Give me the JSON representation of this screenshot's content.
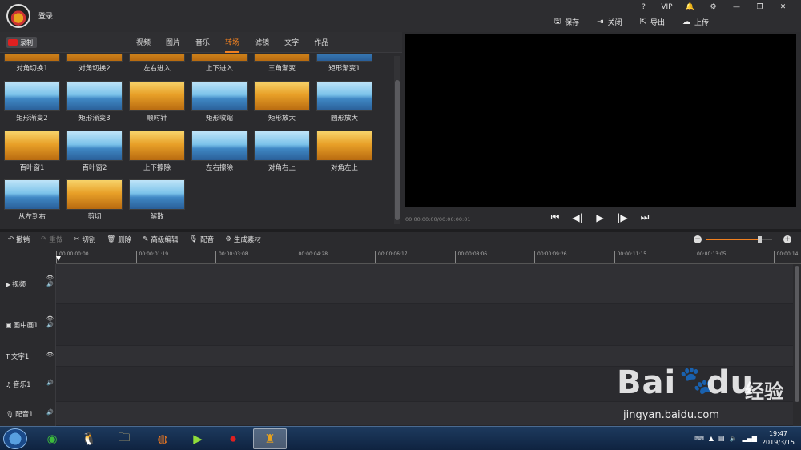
{
  "app": {
    "login_label": "登录",
    "system_icons": [
      "?",
      "VIP",
      "🔔",
      "⚙",
      "—",
      "❐",
      "✕"
    ],
    "actions": [
      {
        "icon": "save-icon",
        "glyph": "🖫",
        "label": "保存"
      },
      {
        "icon": "close-doc-icon",
        "glyph": "⇥",
        "label": "关闭"
      },
      {
        "icon": "export-icon",
        "glyph": "⇱",
        "label": "导出"
      },
      {
        "icon": "upload-icon",
        "glyph": "☁",
        "label": "上传"
      }
    ]
  },
  "library": {
    "record_label": "录制",
    "tabs": [
      "视频",
      "图片",
      "音乐",
      "转场",
      "滤镜",
      "文字",
      "作品"
    ],
    "active_tab": "转场",
    "transitions": [
      {
        "label": "对角切换1",
        "style": "wheat"
      },
      {
        "label": "对角切换2",
        "style": "wheat"
      },
      {
        "label": "左右进入",
        "style": "wheat"
      },
      {
        "label": "上下进入",
        "style": "wheat"
      },
      {
        "label": "三角渐变",
        "style": "wheat"
      },
      {
        "label": "矩形渐变1",
        "style": "lake"
      },
      {
        "label": "矩形渐变2",
        "style": "lake"
      },
      {
        "label": "矩形渐变3",
        "style": "lake"
      },
      {
        "label": "顺时针",
        "style": "wheat"
      },
      {
        "label": "矩形收缩",
        "style": "lake"
      },
      {
        "label": "矩形放大",
        "style": "wheat"
      },
      {
        "label": "圆形放大",
        "style": "lake"
      },
      {
        "label": "百叶窗1",
        "style": "wheat"
      },
      {
        "label": "百叶窗2",
        "style": "lake"
      },
      {
        "label": "上下擦除",
        "style": "wheat"
      },
      {
        "label": "左右擦除",
        "style": "lake"
      },
      {
        "label": "对角右上",
        "style": "lake"
      },
      {
        "label": "对角左上",
        "style": "wheat"
      },
      {
        "label": "从左到右",
        "style": "lake"
      },
      {
        "label": "剪切",
        "style": "wheat"
      },
      {
        "label": "解散",
        "style": "lake"
      }
    ]
  },
  "preview": {
    "timecode": "00:00:00:00/00:00:00:01",
    "controls": [
      "⏮",
      "◀|",
      "▶",
      "|▶",
      "⏭"
    ]
  },
  "toolbar": {
    "tools": [
      {
        "icon": "undo-icon",
        "glyph": "↶",
        "label": "撤销",
        "enabled": true
      },
      {
        "icon": "redo-icon",
        "glyph": "↷",
        "label": "重做",
        "enabled": false
      },
      {
        "icon": "scissors-icon",
        "glyph": "✂",
        "label": "切割",
        "enabled": true
      },
      {
        "icon": "trash-icon",
        "glyph": "🗑",
        "label": "删除",
        "enabled": true
      },
      {
        "icon": "pencil-icon",
        "glyph": "✎",
        "label": "高级编辑",
        "enabled": true
      },
      {
        "icon": "microphone-icon",
        "glyph": "🎙",
        "label": "配音",
        "enabled": true
      },
      {
        "icon": "generate-icon",
        "glyph": "⚙",
        "label": "生成素材",
        "enabled": true
      }
    ],
    "zoom_level": 0.8
  },
  "timeline": {
    "ruler": [
      "00:00:00:00",
      "00:00:01:19",
      "00:00:03:08",
      "00:00:04:28",
      "00:00:06:17",
      "00:00:08:06",
      "00:00:09:26",
      "00:00:11:15",
      "00:00:13:05",
      "00:00:14:"
    ],
    "tracks": [
      {
        "icon": "▶",
        "name": "视频",
        "side": [
          "👁",
          "🔊"
        ]
      },
      {
        "icon": "▣",
        "name": "画中画1",
        "side": [
          "👁",
          "🔊"
        ]
      },
      {
        "icon": "T",
        "name": "文字1",
        "side": [
          "👁"
        ]
      },
      {
        "icon": "♫",
        "name": "音乐1",
        "side": [
          "🔊"
        ]
      },
      {
        "icon": "🎙",
        "name": "配音1",
        "side": [
          "🔊"
        ]
      }
    ]
  },
  "watermark": {
    "brand": "Bai",
    "brand2": "du",
    "cn": "经验",
    "url": "jingyan.baidu.com"
  },
  "taskbar": {
    "apps": [
      {
        "name": "360-app",
        "glyph": "◉",
        "color": "#3cba3c"
      },
      {
        "name": "qq-app",
        "glyph": "🐧",
        "color": "#ffffff"
      },
      {
        "name": "explorer-app",
        "glyph": "🗀",
        "color": "#f2d37a"
      },
      {
        "name": "firefox-app",
        "glyph": "◍",
        "color": "#f07a20"
      },
      {
        "name": "media-app",
        "glyph": "▶",
        "color": "#8fdc3a"
      },
      {
        "name": "recorder-app",
        "glyph": "⏺",
        "color": "#e02020"
      },
      {
        "name": "editor-app",
        "glyph": "♜",
        "color": "#e8a21c"
      }
    ],
    "time": "19:47",
    "date": "2019/3/15"
  }
}
